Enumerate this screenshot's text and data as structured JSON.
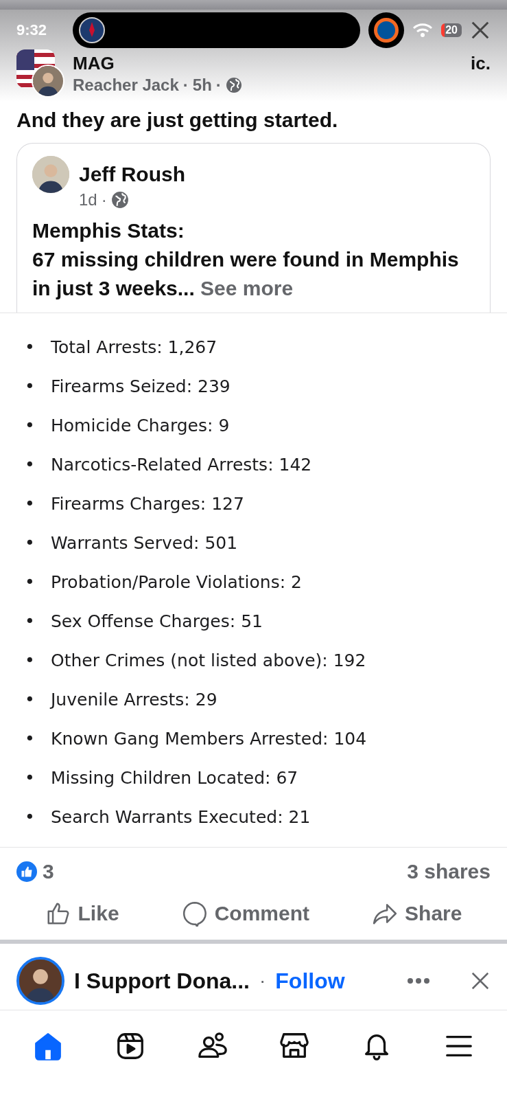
{
  "status_bar": {
    "time": "9:32",
    "battery": "20"
  },
  "post": {
    "group_name_start": "MAG",
    "group_name_end": "ic.",
    "author": "Reacher Jack",
    "separator_1": "·",
    "time": "5h",
    "separator_2": "·",
    "caption": "And they are just getting started.",
    "shared": {
      "author": "Jeff Roush",
      "time": "1d",
      "separator": "·",
      "title": "Memphis Stats:",
      "text": "67 missing children were found in Memphis in just 3 weeks...",
      "see_more": "See more"
    },
    "stats": [
      {
        "bullet": "•",
        "text": "Total Arrests: 1,267"
      },
      {
        "bullet": "•",
        "text": "Firearms Seized: 239"
      },
      {
        "bullet": "•",
        "text": "Homicide Charges: 9"
      },
      {
        "bullet": "•",
        "text": "Narcotics-Related Arrests: 142"
      },
      {
        "bullet": "•",
        "text": "Firearms Charges: 127"
      },
      {
        "bullet": "•",
        "text": "Warrants Served: 501"
      },
      {
        "bullet": "•",
        "text": "Probation/Parole Violations: 2"
      },
      {
        "bullet": "•",
        "text": "Sex Offense Charges: 51"
      },
      {
        "bullet": "•",
        "text": "Other Crimes (not listed above): 192"
      },
      {
        "bullet": "•",
        "text": "Juvenile Arrests: 29"
      },
      {
        "bullet": "•",
        "text": "Known Gang Members Arrested: 104"
      },
      {
        "bullet": "•",
        "text": "Missing Children Located: 67"
      },
      {
        "bullet": "•",
        "text": "Search Warrants Executed: 21"
      }
    ],
    "reactions": "3",
    "shares": "3 shares",
    "actions": [
      {
        "kind": "like",
        "label": "Like"
      },
      {
        "kind": "comment",
        "label": "Comment"
      },
      {
        "kind": "share",
        "label": "Share"
      }
    ]
  },
  "next_post": {
    "page_name": "I Support Dona...",
    "separator": "·",
    "follow": "Follow"
  },
  "bottom_nav": [
    {
      "kind": "home",
      "selected": true
    },
    {
      "kind": "video",
      "selected": false
    },
    {
      "kind": "friends",
      "selected": false
    },
    {
      "kind": "marketplace",
      "selected": false
    },
    {
      "kind": "notifications",
      "selected": false
    },
    {
      "kind": "menu",
      "selected": false
    }
  ]
}
